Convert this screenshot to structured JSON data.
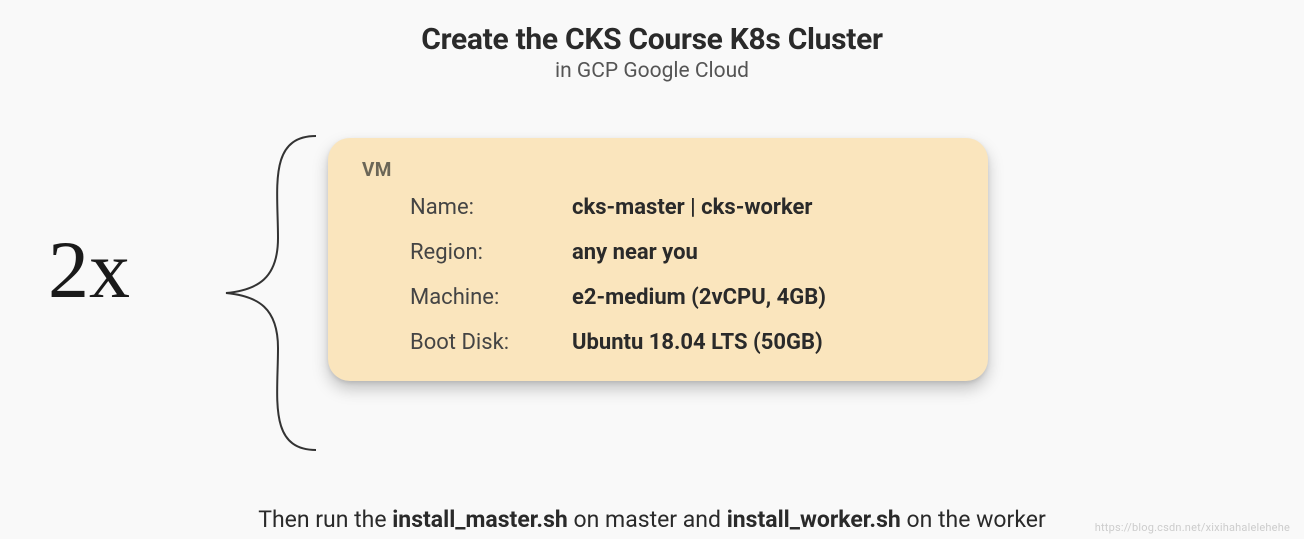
{
  "header": {
    "title": "Create the CKS Course K8s Cluster",
    "subtitle": "in GCP Google Cloud"
  },
  "multiplier": "2x",
  "card": {
    "label": "VM",
    "rows": [
      {
        "label": "Name:",
        "value": "cks-master | cks-worker"
      },
      {
        "label": "Region:",
        "value": "any near you"
      },
      {
        "label": "Machine:",
        "value": "e2-medium (2vCPU, 4GB)"
      },
      {
        "label": "Boot Disk:",
        "value": "Ubuntu 18.04 LTS (50GB)"
      }
    ]
  },
  "footer": {
    "prefix": "Then run the ",
    "script1": "install_master.sh",
    "mid": " on master and ",
    "script2": "install_worker.sh",
    "suffix": " on the worker"
  },
  "watermark": "https://blog.csdn.net/xixihahalelehehe"
}
